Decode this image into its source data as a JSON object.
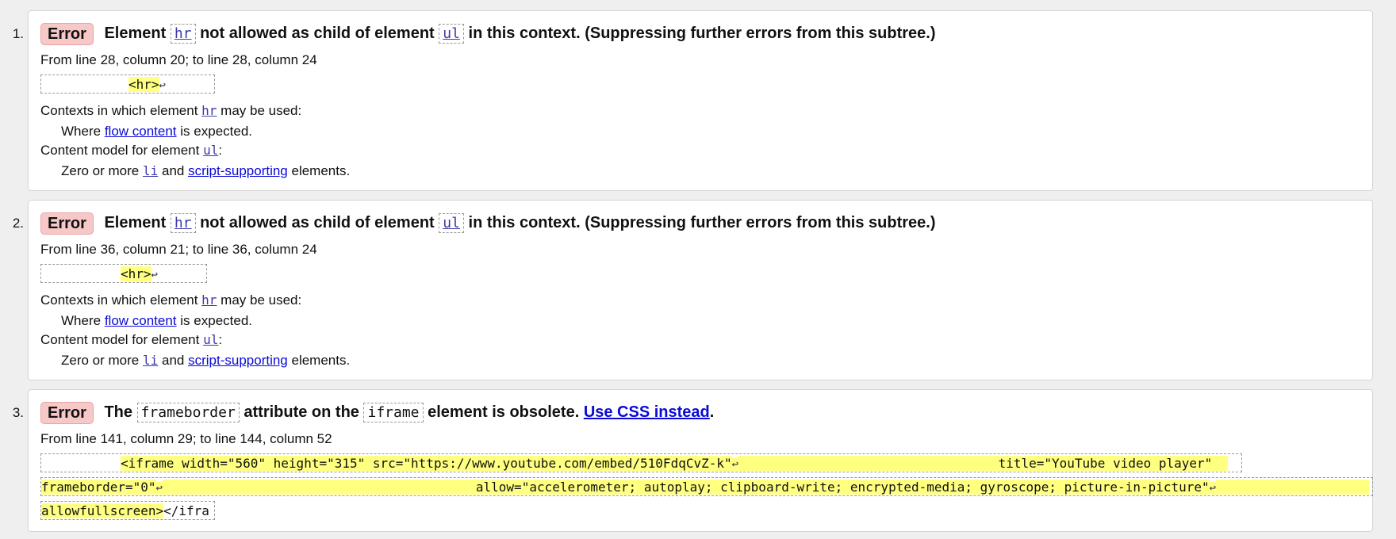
{
  "errors": [
    {
      "number": "1.",
      "badge": "Error",
      "msg_pre": "Element",
      "code1": "hr",
      "msg_mid": "not allowed as child of element",
      "code2": "ul",
      "msg_post": "in this context. (Suppressing further errors from this subtree.)",
      "location": "From line 28, column 20; to line 28, column 24",
      "extract": "<hr>",
      "ctx_label_pre": "Contexts in which element",
      "ctx_label_code": "hr",
      "ctx_label_post": "may be used:",
      "ctx_where": "Where",
      "ctx_link": "flow content",
      "ctx_post": "is expected.",
      "cm_label_pre": "Content model for element",
      "cm_label_code": "ul",
      "cm_label_post": ":",
      "cm_zero": "Zero or more",
      "cm_li": "li",
      "cm_and": "and",
      "cm_link": "script-supporting",
      "cm_post": "elements."
    },
    {
      "number": "2.",
      "badge": "Error",
      "msg_pre": "Element",
      "code1": "hr",
      "msg_mid": "not allowed as child of element",
      "code2": "ul",
      "msg_post": "in this context. (Suppressing further errors from this subtree.)",
      "location": "From line 36, column 21; to line 36, column 24",
      "extract": "<hr>",
      "ctx_label_pre": "Contexts in which element",
      "ctx_label_code": "hr",
      "ctx_label_post": "may be used:",
      "ctx_where": "Where",
      "ctx_link": "flow content",
      "ctx_post": "is expected.",
      "cm_label_pre": "Content model for element",
      "cm_label_code": "ul",
      "cm_label_post": ":",
      "cm_zero": "Zero or more",
      "cm_li": "li",
      "cm_and": "and",
      "cm_link": "script-supporting",
      "cm_post": "elements."
    },
    {
      "number": "3.",
      "badge": "Error",
      "msg_pre": "The",
      "code1": "frameborder",
      "msg_mid": "attribute on the",
      "code2": "iframe",
      "msg_post": "element is obsolete.",
      "msg_link": "Use CSS instead",
      "msg_end": ".",
      "location": "From line 141, column 29; to line 144, column 52",
      "extract_line1": "<iframe width=\"560\" height=\"315\" src=\"https://www.youtube.com/embed/510FdqCvZ-k\"",
      "extract_line1b": "title=\"YouTube video player\"",
      "extract_line2a": "frameborder=\"0\"",
      "extract_line2b": "allow=\"accelerometer; autoplay; clipboard-write; encrypted-media; gyroscope; picture-in-picture\"",
      "extract_line3a": "allowfullscreen>",
      "extract_line3b": "</ifra"
    }
  ],
  "icons": {
    "line_feed": "↩"
  }
}
